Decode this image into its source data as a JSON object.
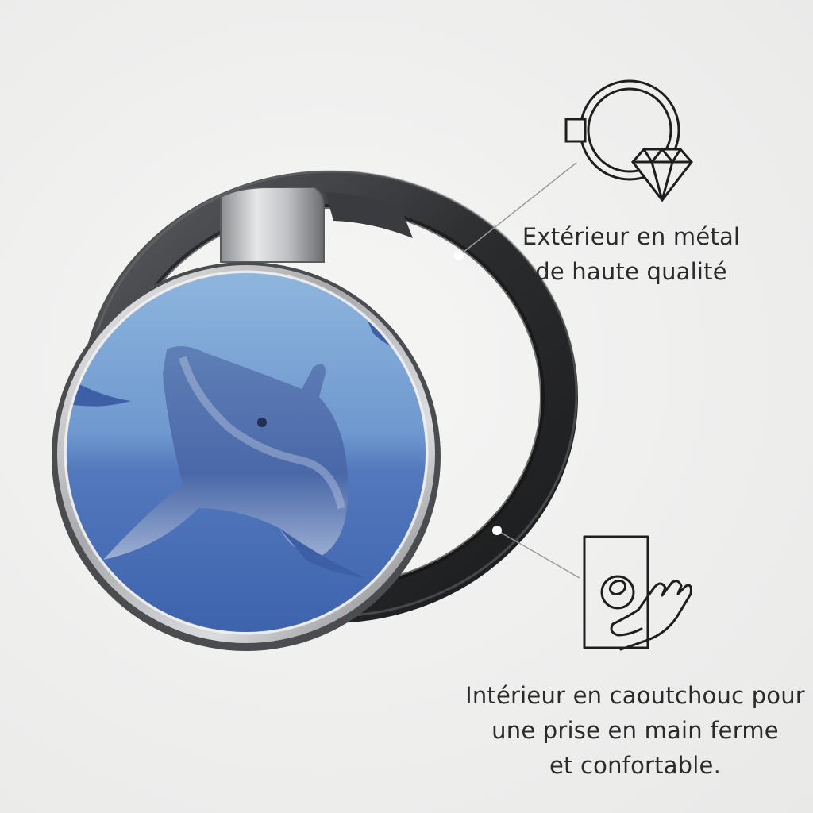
{
  "callouts": {
    "metal": {
      "icon": "ring-with-diamond-icon",
      "line1": "Extérieur en métal",
      "line2": "de haute qualité"
    },
    "rubber": {
      "icon": "finger-grip-icon",
      "line1": "Intérieur en caoutchouc pour",
      "line2": "une prise en main ferme",
      "line3": "et confortable."
    }
  },
  "product": {
    "illustration": "dolphin",
    "colors": {
      "ring": "#2c2d2f",
      "metal": "#c8c9cb",
      "water_top": "#8fb6dd",
      "water_bottom": "#3d63ad"
    }
  }
}
